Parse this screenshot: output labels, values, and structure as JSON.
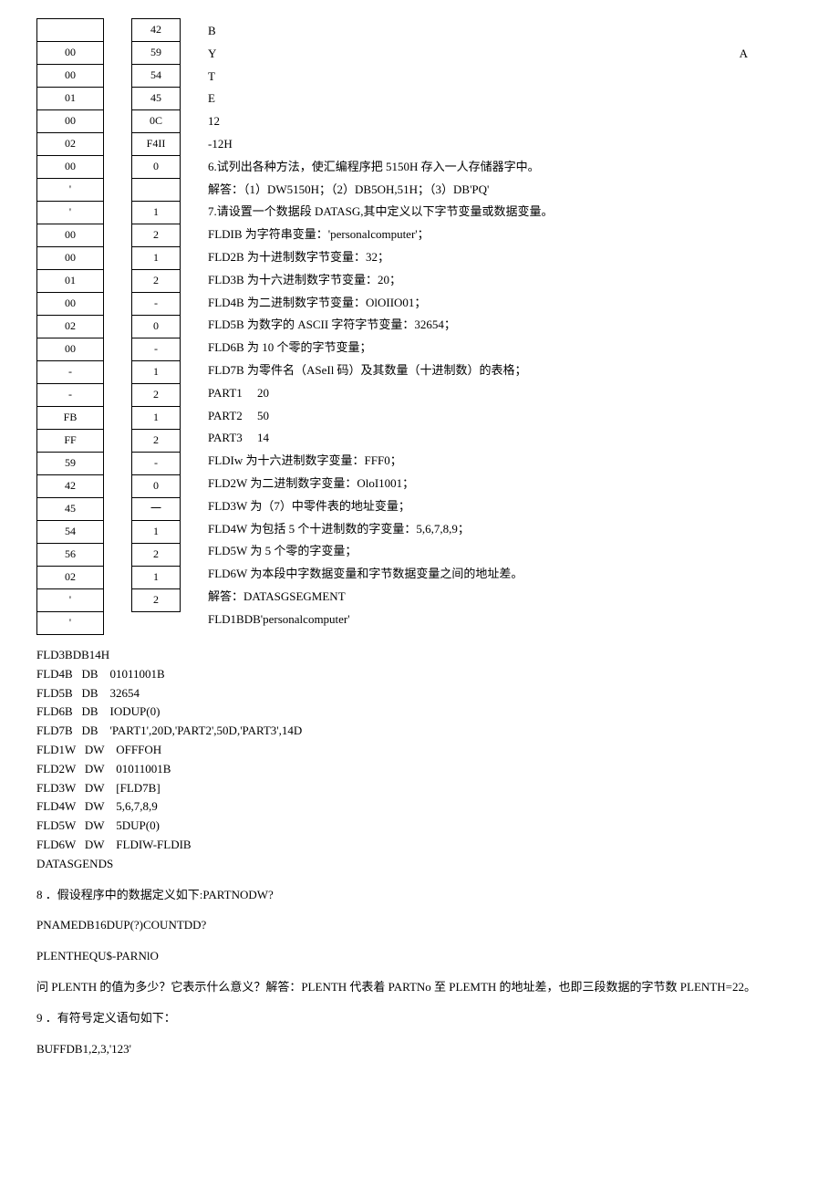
{
  "table1": [
    "",
    "00",
    "00",
    "01",
    "00",
    "02",
    "00",
    "'",
    "'",
    "00",
    "00",
    "01",
    "00",
    "02",
    "00",
    "-",
    "-",
    "FB",
    "FF",
    "59",
    "42",
    "45",
    "54",
    "56",
    "02",
    "'",
    "'"
  ],
  "table2": [
    "42",
    "59",
    "54",
    "45",
    "0C",
    "F4II",
    "0",
    "",
    "1",
    "2",
    "1",
    "2",
    "-",
    "0",
    "-",
    "1",
    "2",
    "1",
    "2",
    "-",
    "0",
    "一",
    "1",
    "2",
    "1",
    "2"
  ],
  "side": [
    "B",
    "Y",
    "T",
    "E",
    "12",
    "-12H"
  ],
  "side_far": "A",
  "q6_title": "6.试列出各种方法，使汇编程序把 5150H 存入一人存储器字中。",
  "q6_ans": "解答：（1）DW5150H；（2）DB5OH,51H；（3）DB'PQ'",
  "q7_title": "7.请设置一个数据段 DATASG,其中定义以下字节变量或数据变量。",
  "q7_lines": [
    "FLDIB 为字符串变量：'personalcomputer'；",
    "FLD2B 为十进制数字节变量：32；",
    "FLD3B 为十六进制数字节变量：20；",
    "FLD4B 为二进制数字节变量：OlOIIO01；",
    "FLD5B 为数字的 ASCII 字符字节变量：32654；",
    "FLD6B 为 10 个零的字节变量；",
    "FLD7B 为零件名（ASeIl 码）及其数量（十进制数）的表格；"
  ],
  "parts": [
    {
      "label": "PART1",
      "val": "20"
    },
    {
      "label": "PART2",
      "val": "50"
    },
    {
      "label": "PART3",
      "val": "14"
    }
  ],
  "q7_lines2": [
    "FLDIw 为十六进制数字变量：FFF0；",
    "FLD2W 为二进制数字变量：OloI1001；",
    "FLD3W 为（7）中零件表的地址变量；",
    "FLD4W 为包括 5 个十进制数的字变量：5,6,7,8,9；",
    "FLD5W 为 5 个零的字变量；",
    "FLD6W 为本段中字数据变量和字节数据变量之间的地址差。"
  ],
  "q7_ans_head": "解答：DATASGSEGMENT",
  "q7_ans_line1": "FLD1BDB'personalcomputer'",
  "code_block": {
    "l0": "FLD3BDB14H",
    "l1": "FLD4B   DB    01011001B",
    "l2": "FLD5B   DB    32654",
    "l3": "FLD6B   DB    IODUP(0)",
    "l4": "FLD7B   DB    'PART1',20D,'PART2',50D,'PART3',14D",
    "l5": "FLD1W   DW    OFFFOH",
    "l6": "FLD2W   DW    01011001B",
    "l7": "FLD3W   DW    [FLD7B]",
    "l8": "FLD4W   DW    5,6,7,8,9",
    "l9": "FLD5W   DW    5DUP(0)",
    "l10": "FLD6W   DW    FLDIW-FLDIB",
    "l11": "DATASGENDS"
  },
  "q8_title": "8 ．假设程序中的数据定义如下:PARTNODW?",
  "q8_a": "PNAMEDB16DUP(?)COUNTDD?",
  "q8_b": "PLENTHEQU$-PARNlO",
  "q8_ans": "问 PLENTH 的值为多少？它表示什么意义？解答：PLENTH 代表着 PARTNo 至 PLEMTH 的地址差，也即三段数据的字节数 PLENTH=22。",
  "q9_title": "9 ．有符号定义语句如下：",
  "q9_a": "BUFFDB1,2,3,'123'"
}
